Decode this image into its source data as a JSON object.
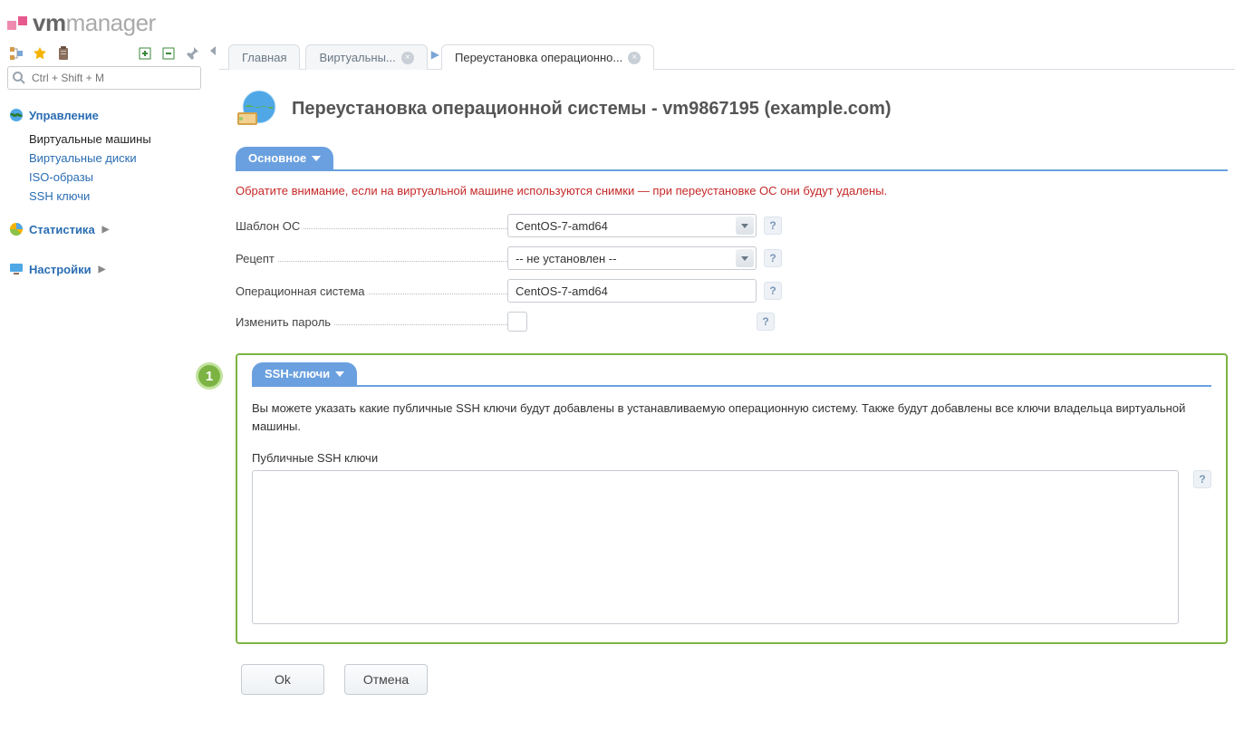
{
  "logo": {
    "strong": "vm",
    "light": "manager"
  },
  "search": {
    "placeholder": "Ctrl + Shift + M"
  },
  "sidebar": {
    "sections": [
      {
        "title": "Управление",
        "expandable": false,
        "items": [
          {
            "label": "Виртуальные машины",
            "active": true
          },
          {
            "label": "Виртуальные диски",
            "active": false
          },
          {
            "label": "ISO-образы",
            "active": false
          },
          {
            "label": "SSH ключи",
            "active": false
          }
        ]
      },
      {
        "title": "Статистика",
        "expandable": true,
        "items": []
      },
      {
        "title": "Настройки",
        "expandable": true,
        "items": []
      }
    ]
  },
  "tabs": [
    {
      "label": "Главная",
      "closable": false,
      "active": false
    },
    {
      "label": "Виртуальны...",
      "closable": true,
      "active": false,
      "arrow_after": true
    },
    {
      "label": "Переустановка операционно...",
      "closable": true,
      "active": true
    }
  ],
  "page": {
    "title": "Переустановка операционной системы - vm9867195 (example.com)"
  },
  "section_main": {
    "chip": "Основное",
    "warning": "Обратите внимание, если на виртуальной машине используются снимки — при переустановке ОС они будут удалены.",
    "rows": {
      "template_label": "Шаблон ОС",
      "template_value": "CentOS-7-amd64",
      "recipe_label": "Рецепт",
      "recipe_value": "-- не установлен --",
      "os_label": "Операционная система",
      "os_value": "CentOS-7-amd64",
      "chpass_label": "Изменить пароль"
    }
  },
  "section_ssh": {
    "badge": "1",
    "chip": "SSH-ключи",
    "desc": "Вы можете указать какие публичные SSH ключи будут добавлены в устанавливаемую операционную систему. Также будут добавлены все ключи владельца виртуальной машины.",
    "field_label": "Публичные SSH ключи",
    "field_value": ""
  },
  "buttons": {
    "ok": "Ok",
    "cancel": "Отмена"
  },
  "help_glyph": "?"
}
